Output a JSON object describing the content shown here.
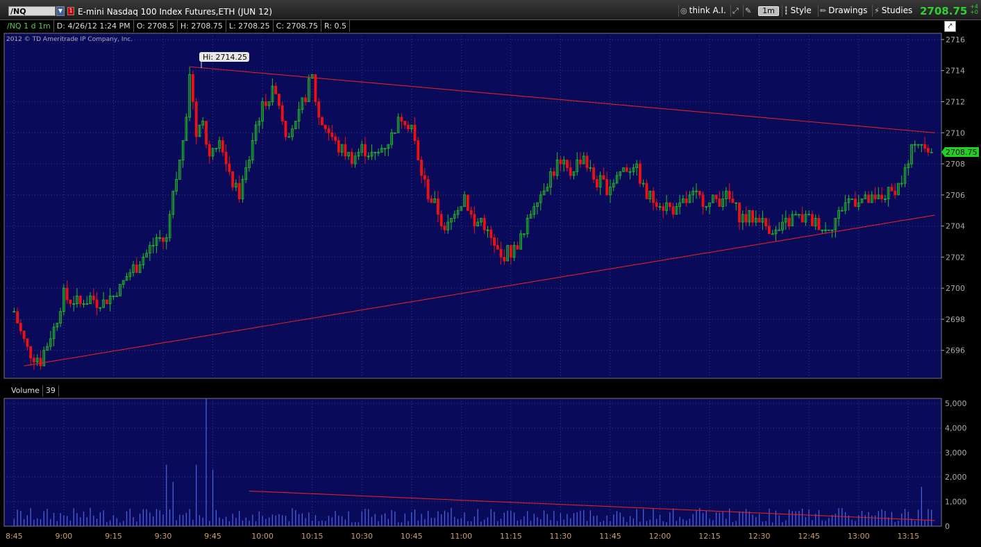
{
  "toolbar": {
    "symbol": "/NQ",
    "product_name": "E-mini Nasdaq 100 Index Futures,ETH (JUN 12)",
    "think_ai_label": "think A.I.",
    "timeframe_label": "1m",
    "style_label": "Style",
    "drawings_label": "Drawings",
    "studies_label": "Studies",
    "last_price": "2708.75",
    "net_change_top": "+4",
    "net_change_bottom": "+0"
  },
  "infobar": {
    "symbol_period": "/NQ 1 d 1m",
    "date": "D: 4/26/12 1:24 PM",
    "open": "O: 2708.5",
    "high": "H: 2708.75",
    "low": "L: 2708.25",
    "close": "C: 2708.75",
    "range": "R: 0.5"
  },
  "copyright": "2012 © TD Ameritrade IP Company, Inc.",
  "hi_marker": "Hi: 2714.25",
  "last_price_tag": "2708.75",
  "volume_panel": {
    "label": "Volume",
    "value": "39"
  },
  "colors": {
    "background": "#0a0a5a",
    "up": "#22c022",
    "down": "#ee1111",
    "volume": "#4a60d8",
    "trendline": "#e02020"
  },
  "chart_data": [
    {
      "type": "candlestick",
      "price_ticks": [
        "2716",
        "2714",
        "2712",
        "2710",
        "2708",
        "2706",
        "2704",
        "2702",
        "2700",
        "2698",
        "2696"
      ],
      "ylim": [
        2694.2,
        2716.4
      ],
      "time_ticks": [
        "8:45",
        "9:00",
        "9:15",
        "9:30",
        "9:45",
        "10:00",
        "10:15",
        "10:30",
        "10:45",
        "11:00",
        "11:15",
        "11:30",
        "11:45",
        "12:00",
        "12:15",
        "12:30",
        "12:45",
        "13:00",
        "13:15"
      ],
      "close_path": [
        [
          "8:45",
          2698.5
        ],
        [
          "8:49",
          2696.0
        ],
        [
          "8:53",
          2695.3
        ],
        [
          "8:57",
          2697.5
        ],
        [
          "9:00",
          2699.5
        ],
        [
          "9:04",
          2699.0
        ],
        [
          "9:08",
          2699.3
        ],
        [
          "9:12",
          2699.0
        ],
        [
          "9:16",
          2699.8
        ],
        [
          "9:20",
          2701.0
        ],
        [
          "9:24",
          2702.0
        ],
        [
          "9:28",
          2703.2
        ],
        [
          "9:31",
          2703.0
        ],
        [
          "9:33",
          2706.0
        ],
        [
          "9:35",
          2708.0
        ],
        [
          "9:37",
          2711.5
        ],
        [
          "9:38",
          2714.0
        ],
        [
          "9:40",
          2710.0
        ],
        [
          "9:42",
          2711.0
        ],
        [
          "9:44",
          2708.5
        ],
        [
          "9:47",
          2710.0
        ],
        [
          "9:50",
          2707.0
        ],
        [
          "9:53",
          2706.0
        ],
        [
          "9:55",
          2707.5
        ],
        [
          "9:58",
          2710.5
        ],
        [
          "10:01",
          2712.0
        ],
        [
          "10:04",
          2713.0
        ],
        [
          "10:07",
          2710.0
        ],
        [
          "10:10",
          2710.5
        ],
        [
          "10:13",
          2712.5
        ],
        [
          "10:15",
          2713.5
        ],
        [
          "10:17",
          2711.0
        ],
        [
          "10:20",
          2710.0
        ],
        [
          "10:23",
          2709.0
        ],
        [
          "10:27",
          2708.5
        ],
        [
          "10:30",
          2709.0
        ],
        [
          "10:34",
          2708.5
        ],
        [
          "10:38",
          2709.5
        ],
        [
          "10:42",
          2711.0
        ],
        [
          "10:45",
          2710.5
        ],
        [
          "10:47",
          2708.0
        ],
        [
          "10:50",
          2706.0
        ],
        [
          "10:53",
          2705.0
        ],
        [
          "10:55",
          2703.5
        ],
        [
          "10:58",
          2705.0
        ],
        [
          "11:01",
          2706.0
        ],
        [
          "11:04",
          2704.0
        ],
        [
          "11:06",
          2704.5
        ],
        [
          "11:09",
          2703.0
        ],
        [
          "11:12",
          2702.0
        ],
        [
          "11:16",
          2702.5
        ],
        [
          "11:19",
          2703.5
        ],
        [
          "11:22",
          2705.5
        ],
        [
          "11:25",
          2706.5
        ],
        [
          "11:29",
          2708.0
        ],
        [
          "11:33",
          2707.5
        ],
        [
          "11:37",
          2708.5
        ],
        [
          "11:40",
          2707.0
        ],
        [
          "11:44",
          2706.5
        ],
        [
          "11:48",
          2707.5
        ],
        [
          "11:52",
          2708.0
        ],
        [
          "11:56",
          2706.0
        ],
        [
          "12:00",
          2705.5
        ],
        [
          "12:05",
          2705.0
        ],
        [
          "12:10",
          2706.0
        ],
        [
          "12:15",
          2705.5
        ],
        [
          "12:20",
          2706.0
        ],
        [
          "12:25",
          2704.5
        ],
        [
          "12:30",
          2704.5
        ],
        [
          "12:35",
          2703.5
        ],
        [
          "12:40",
          2704.5
        ],
        [
          "12:45",
          2704.5
        ],
        [
          "12:50",
          2703.8
        ],
        [
          "12:53",
          2704.5
        ],
        [
          "12:56",
          2705.5
        ],
        [
          "13:00",
          2705.8
        ],
        [
          "13:04",
          2705.5
        ],
        [
          "13:08",
          2706.0
        ],
        [
          "13:12",
          2706.5
        ],
        [
          "13:15",
          2708.0
        ],
        [
          "13:17",
          2709.5
        ],
        [
          "13:20",
          2709.2
        ],
        [
          "13:22",
          2708.75
        ]
      ],
      "high": 2714.25,
      "last": 2708.75,
      "trendlines": [
        {
          "from": [
            "9:38",
            2714.25
          ],
          "to": [
            "13:23",
            2710.0
          ]
        },
        {
          "from": [
            "8:48",
            2695.0
          ],
          "to": [
            "13:23",
            2704.7
          ]
        }
      ]
    },
    {
      "type": "bar",
      "series": "Volume",
      "ticks": [
        "5,000",
        "4,000",
        "3,000",
        "2,000",
        "1,000",
        "0"
      ],
      "ylim": [
        0,
        5200
      ],
      "typical_volume": 500,
      "spikes": [
        [
          "9:31",
          2500
        ],
        [
          "9:33",
          1800
        ],
        [
          "9:40",
          2500
        ],
        [
          "9:43",
          5200
        ],
        [
          "9:45",
          2300
        ],
        [
          "13:19",
          1600
        ]
      ],
      "trendline": {
        "from": [
          "9:56",
          1430
        ],
        "to": [
          "13:23",
          230
        ]
      }
    }
  ]
}
